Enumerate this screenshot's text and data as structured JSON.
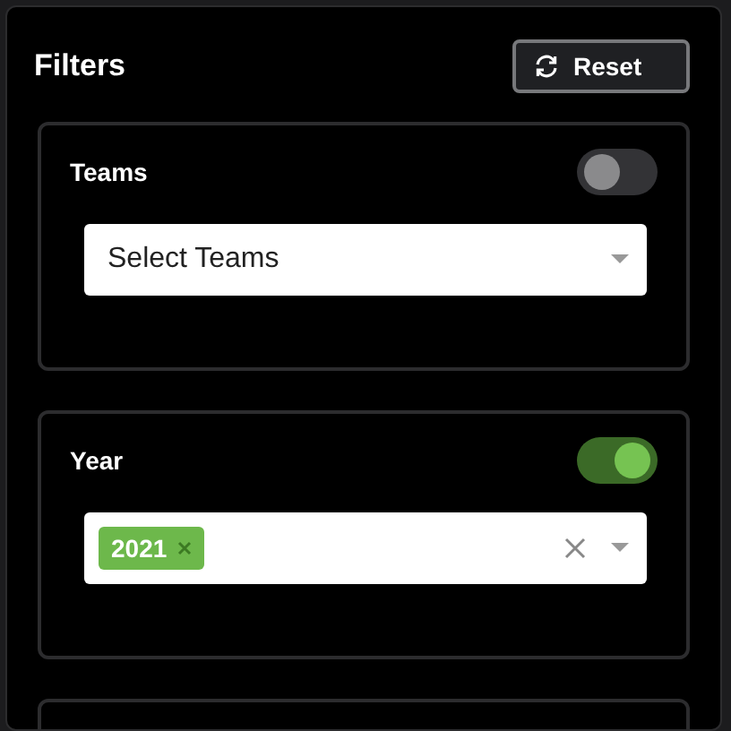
{
  "title": "Filters",
  "reset_button": {
    "label": "Reset"
  },
  "sections": [
    {
      "kind": "select",
      "label": "Teams",
      "on": false,
      "placeholder": "Select Teams"
    },
    {
      "kind": "tags",
      "label": "Year",
      "on": true,
      "tags": [
        "2021"
      ]
    },
    {
      "kind": "cut"
    }
  ]
}
